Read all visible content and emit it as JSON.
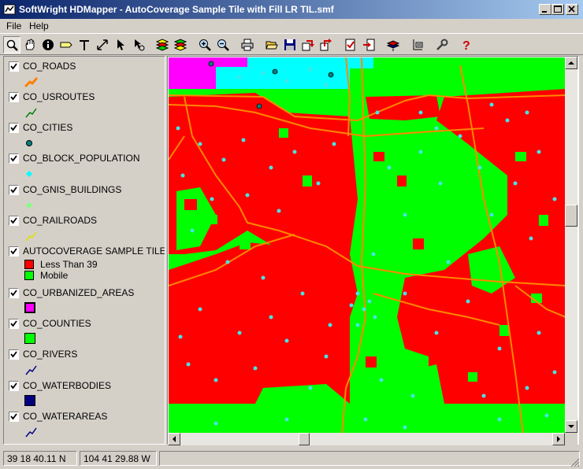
{
  "window": {
    "title": "SoftWright HDMapper - AutoCoverage Sample Tile with Fill LR TIL.smf"
  },
  "menu": [
    {
      "label": "File"
    },
    {
      "label": "Help"
    }
  ],
  "toolbar": {
    "buttons": [
      {
        "icon": "zoom-select-icon",
        "pressed": true
      },
      {
        "icon": "pan-hand-icon"
      },
      {
        "icon": "info-icon"
      },
      {
        "icon": "label-icon"
      },
      {
        "icon": "text-icon"
      },
      {
        "icon": "measure-icon"
      },
      {
        "icon": "select-arrow-icon"
      },
      {
        "icon": "select-feature-icon"
      },
      {
        "icon": "layers-icon"
      },
      {
        "icon": "layers-alt-icon"
      },
      {
        "icon": "zoom-in-icon"
      },
      {
        "icon": "zoom-out-icon"
      },
      {
        "icon": "print-icon"
      },
      {
        "icon": "open-folder-icon"
      },
      {
        "icon": "save-icon"
      },
      {
        "icon": "export-icon"
      },
      {
        "icon": "export-alt-icon"
      },
      {
        "icon": "properties-icon"
      },
      {
        "icon": "import-icon"
      },
      {
        "icon": "add-layer-icon"
      },
      {
        "icon": "layer-list-icon"
      },
      {
        "icon": "tools-icon"
      },
      {
        "icon": "help-icon"
      }
    ]
  },
  "legend": {
    "layers": [
      {
        "name": "CO_ROADS",
        "checked": true,
        "symbol": "road",
        "color": "#ff8000"
      },
      {
        "name": "CO_USROUTES",
        "checked": true,
        "symbol": "line",
        "color": "#008000"
      },
      {
        "name": "CO_CITIES",
        "checked": true,
        "symbol": "dot",
        "color": "#008080"
      },
      {
        "name": "CO_BLOCK_POPULATION",
        "checked": true,
        "symbol": "diamond",
        "color": "#00ffff"
      },
      {
        "name": "CO_GNIS_BUILDINGS",
        "checked": true,
        "symbol": "diamond",
        "color": "#80ff80"
      },
      {
        "name": "CO_RAILROADS",
        "checked": true,
        "symbol": "line",
        "color": "#ffff00"
      },
      {
        "name": "AUTOCOVERAGE SAMPLE TILE WITH FILL LR TIL",
        "checked": true,
        "symbol": "classes"
      },
      {
        "name": "CO_URBANIZED_AREAS",
        "checked": true,
        "symbol": "fill",
        "color": "#ff00ff"
      },
      {
        "name": "CO_COUNTIES",
        "checked": true,
        "symbol": "fill",
        "color": "#00ff00"
      },
      {
        "name": "CO_RIVERS",
        "checked": true,
        "symbol": "line",
        "color": "#000080"
      },
      {
        "name": "CO_WATERBODIES",
        "checked": true,
        "symbol": "fill",
        "color": "#000080"
      },
      {
        "name": "CO_WATERAREAS",
        "checked": true,
        "symbol": "line",
        "color": "#000080"
      }
    ],
    "coverage_classes": [
      {
        "label": "Less Than 39",
        "color": "#ff0000"
      },
      {
        "label": "Mobile",
        "color": "#00ff00"
      }
    ]
  },
  "map": {
    "colors": {
      "below_threshold": "#ff0000",
      "mobile": "#00ff00",
      "urbanized": "#ff00ff",
      "population": "#44e5e5",
      "roads": "#ff8800",
      "top_band": "#00ffff"
    }
  },
  "status": {
    "latitude": "39 18 40.11 N",
    "longitude": "104 41 29.88 W"
  }
}
